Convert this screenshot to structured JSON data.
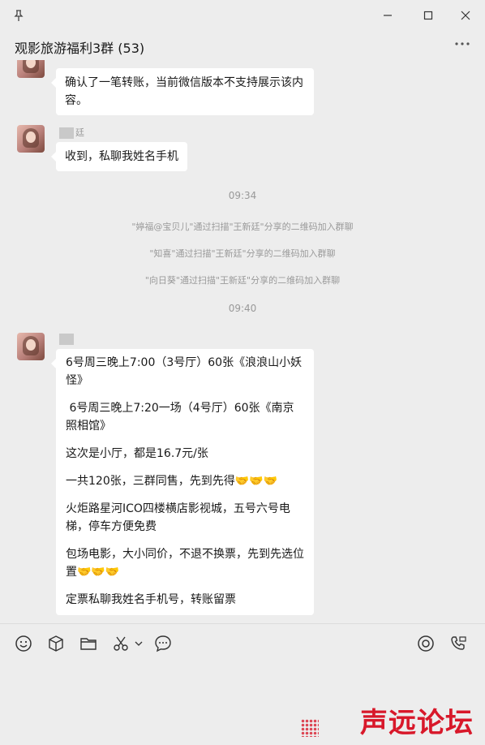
{
  "window": {
    "title": "观影旅游福利3群 (53)",
    "controls": [
      "minimize",
      "maximize",
      "close"
    ]
  },
  "messages": [
    {
      "type": "msg",
      "sender": "",
      "text": "确认了一笔转账，当前微信版本不支持展示该内容。"
    },
    {
      "type": "msg",
      "sender": "廷",
      "text": "收到，私聊我姓名手机"
    },
    {
      "type": "time",
      "text": "09:34"
    },
    {
      "type": "system",
      "text": "\"婷福@宝贝儿\"通过扫描\"王新廷\"分享的二维码加入群聊"
    },
    {
      "type": "system",
      "text": "\"知喜\"通过扫描\"王新廷\"分享的二维码加入群聊"
    },
    {
      "type": "system",
      "text": "\"向日葵\"通过扫描\"王新廷\"分享的二维码加入群聊"
    },
    {
      "type": "time",
      "text": "09:40"
    },
    {
      "type": "msg",
      "sender": "",
      "paragraphs": [
        "6号周三晚上7:00（3号厅）60张《浪浪山小妖怪》",
        " 6号周三晚上7:20一场（4号厅）60张《南京照相馆》",
        "这次是小厅，都是16.7元/张",
        "一共120张，三群同售，先到先得🤝🤝🤝",
        "火炬路星河ICO四楼横店影视城，五号六号电梯，停车方便免费",
        "包场电影，大小同价，不退不换票，先到先选位置🤝🤝🤝",
        "定票私聊我姓名手机号，转账留票"
      ]
    }
  ],
  "toolbar": {
    "icons": [
      "emoji-icon",
      "box-icon",
      "folder-icon",
      "scissors-icon",
      "chevron-down-icon",
      "chat-bubble-icon",
      "record-icon",
      "phone-icon"
    ]
  },
  "watermark": "声远论坛",
  "colors": {
    "background": "#ededed",
    "bubble": "#ffffff",
    "watermark": "#d8182a"
  }
}
